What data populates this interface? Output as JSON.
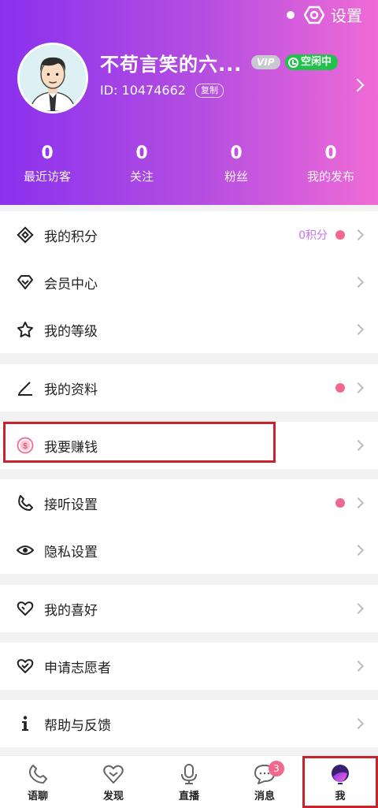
{
  "header": {
    "settings_label": "设置",
    "nickname": "不苟言笑的六...",
    "vip_label": "VIP",
    "status_label": "空闲中",
    "id_text": "ID: 10474662",
    "copy_label": "复制",
    "stats": [
      {
        "value": "0",
        "label": "最近访客"
      },
      {
        "value": "0",
        "label": "关注"
      },
      {
        "value": "0",
        "label": "粉丝"
      },
      {
        "value": "0",
        "label": "我的发布"
      }
    ]
  },
  "menu": {
    "points": {
      "label": "我的积分",
      "extra": "0积分",
      "icon": "diamond-icon"
    },
    "vip_center": {
      "label": "会员中心",
      "icon": "gem-icon"
    },
    "level": {
      "label": "我的等级",
      "icon": "star-icon"
    },
    "profile": {
      "label": "我的资料",
      "icon": "pen-icon"
    },
    "earn": {
      "label": "我要赚钱",
      "icon": "money-icon"
    },
    "answer_settings": {
      "label": "接听设置",
      "icon": "phone-icon"
    },
    "privacy": {
      "label": "隐私设置",
      "icon": "eye-icon"
    },
    "hobbies": {
      "label": "我的喜好",
      "icon": "heart-icon"
    },
    "volunteer": {
      "label": "申请志愿者",
      "icon": "heart-check-icon"
    },
    "help": {
      "label": "帮助与反馈",
      "icon": "info-icon"
    }
  },
  "tabs": [
    {
      "label": "语聊",
      "icon": "phone-tab-icon"
    },
    {
      "label": "发现",
      "icon": "heart-tab-icon"
    },
    {
      "label": "直播",
      "icon": "mic-tab-icon"
    },
    {
      "label": "消息",
      "icon": "chat-tab-icon",
      "badge": "3"
    },
    {
      "label": "我",
      "icon": "me-tab-icon"
    }
  ],
  "colors": {
    "accent": "#8a31ee",
    "pink": "#f06bd6",
    "dot": "#f0678f",
    "highlight": "#c8232c"
  }
}
